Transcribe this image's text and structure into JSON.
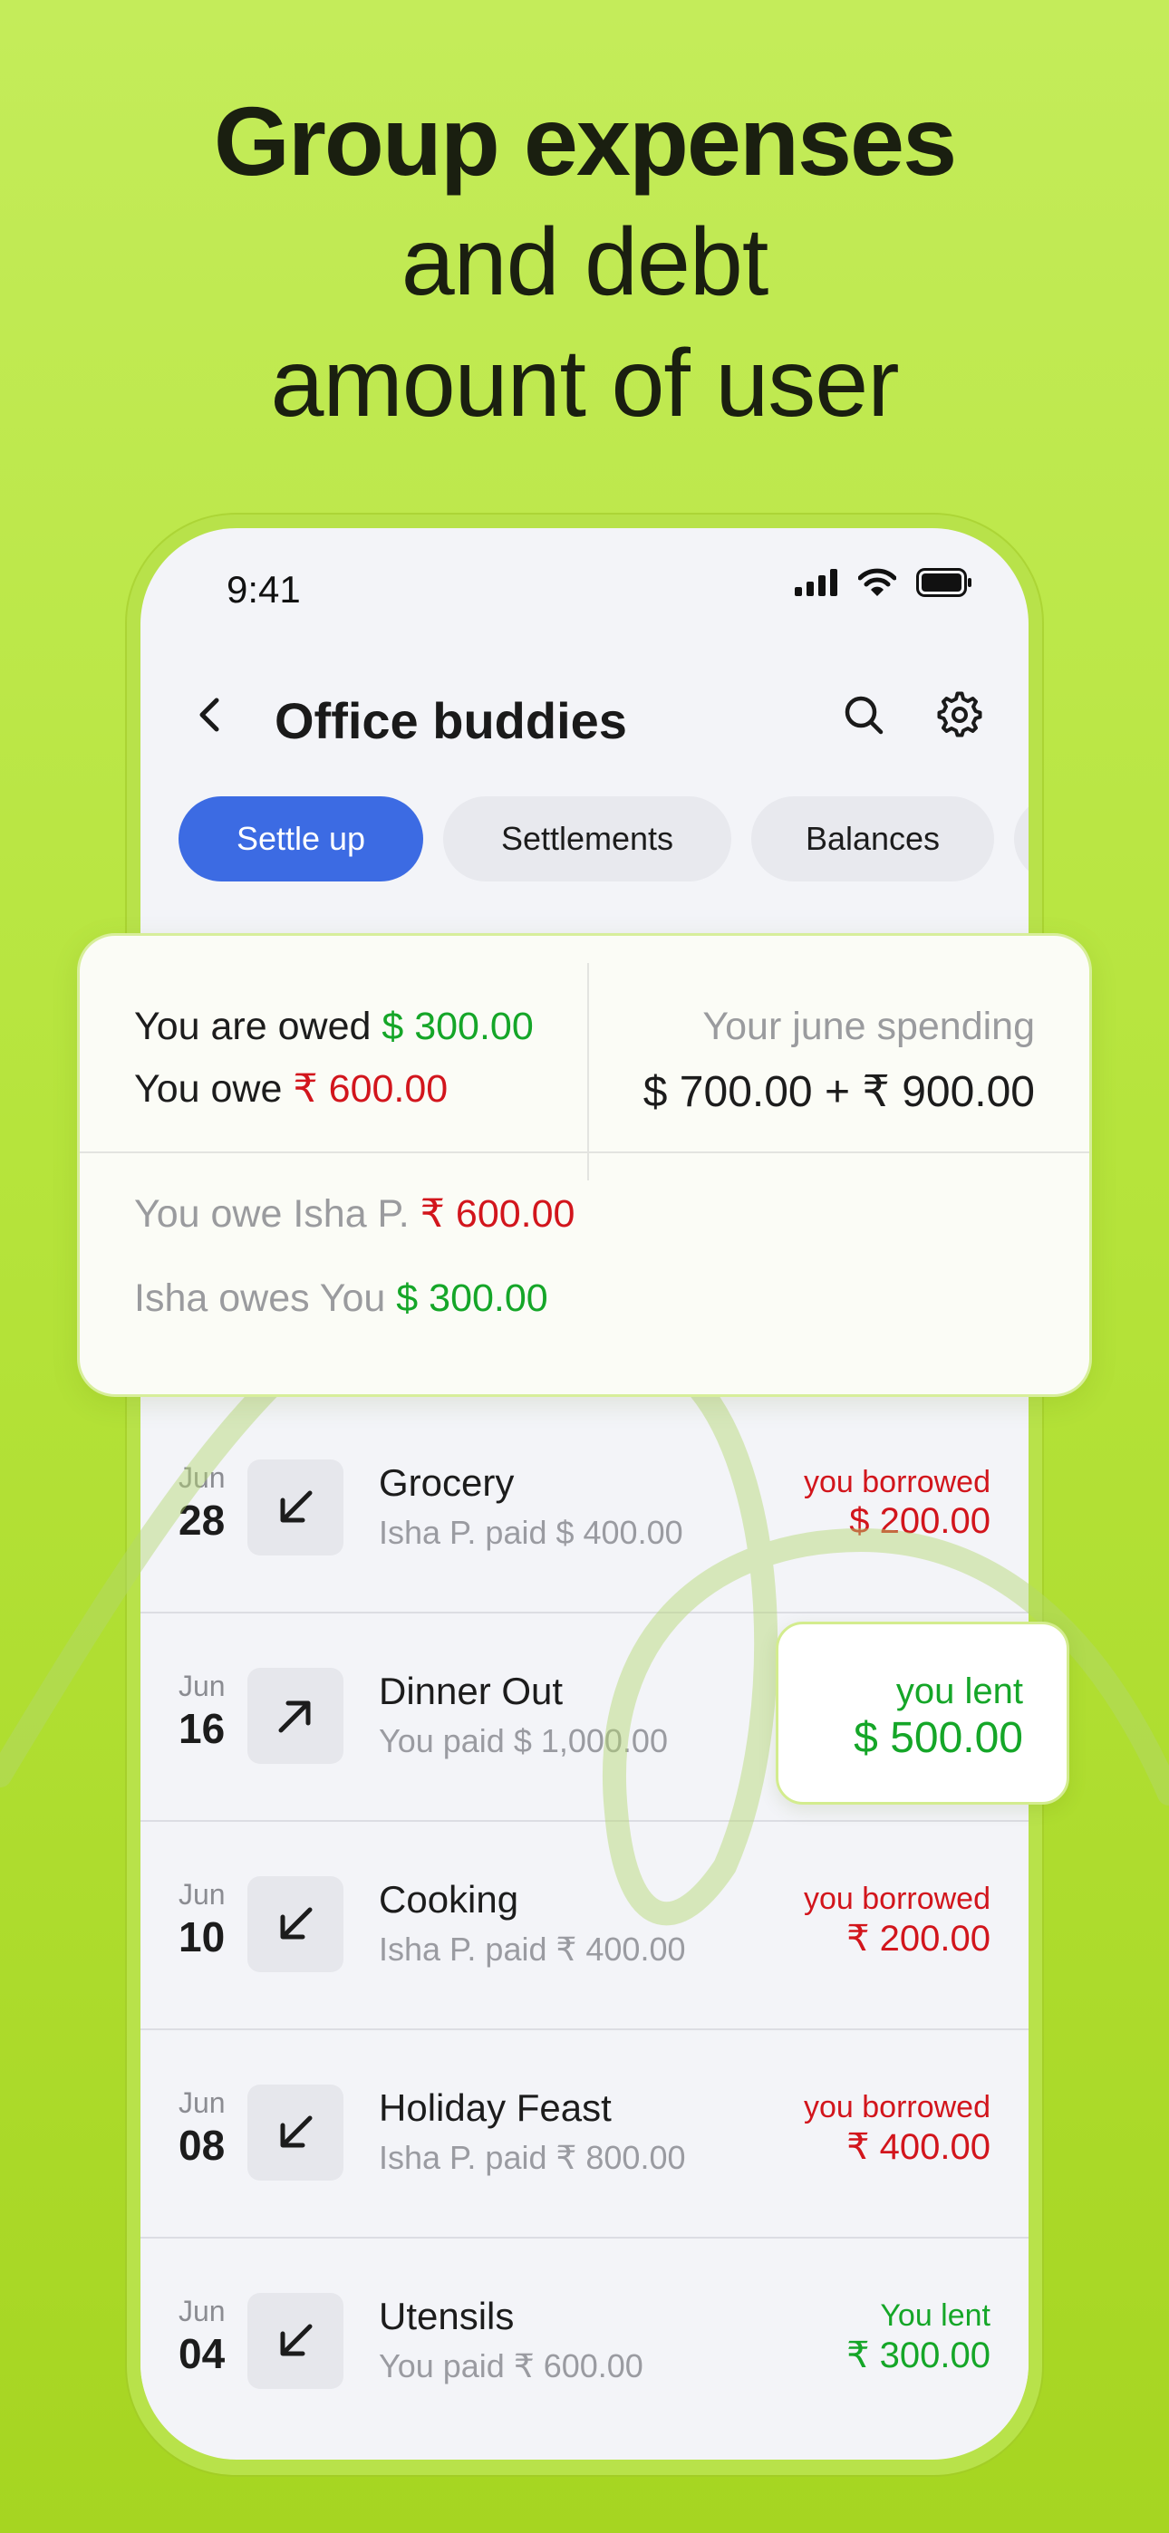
{
  "hero": {
    "line1": "Group expenses",
    "line2": "and debt",
    "line3": "amount of user"
  },
  "status": {
    "time": "9:41"
  },
  "header": {
    "title": "Office buddies"
  },
  "tabs": [
    {
      "label": "Settle up"
    },
    {
      "label": "Settlements"
    },
    {
      "label": "Balances"
    }
  ],
  "summary": {
    "owed_label": "You are owed ",
    "owed_amount": "$ 300.00",
    "owe_label": "You owe ",
    "owe_amount": "₹ 600.00",
    "spending_label": "Your june spending",
    "spending_amount": "$ 700.00 + ₹ 900.00",
    "detail1_label": "You owe Isha P. ",
    "detail1_amount": "₹ 600.00",
    "detail2_label": "Isha owes You ",
    "detail2_amount": "$ 300.00"
  },
  "transactions": [
    {
      "month": "Jun",
      "day": "28",
      "name": "Grocery",
      "sub": "Isha P. paid $ 400.00",
      "status": "you borrowed",
      "amount": "$ 200.00",
      "direction": "in"
    },
    {
      "month": "Jun",
      "day": "16",
      "name": "Dinner Out",
      "sub": "You paid $ 1,000.00",
      "status": "you lent",
      "amount": "$ 500.00",
      "direction": "out"
    },
    {
      "month": "Jun",
      "day": "10",
      "name": "Cooking",
      "sub": "Isha P. paid ₹ 400.00",
      "status": "you borrowed",
      "amount": "₹ 200.00",
      "direction": "in"
    },
    {
      "month": "Jun",
      "day": "08",
      "name": "Holiday Feast",
      "sub": "Isha P. paid ₹ 800.00",
      "status": "you borrowed",
      "amount": "₹ 400.00",
      "direction": "in"
    },
    {
      "month": "Jun",
      "day": "04",
      "name": "Utensils",
      "sub": "You paid ₹ 600.00",
      "status": "You lent",
      "amount": "₹ 300.00",
      "direction": "in"
    }
  ],
  "colors": {
    "accent": "#3c6be3",
    "debt": "#d2151c",
    "credit": "#15a628",
    "background": "#b6e43c"
  },
  "icons": [
    "back-arrow-icon",
    "search-icon",
    "gear-icon",
    "signal-icon",
    "wifi-icon",
    "battery-icon",
    "arrow-down-left-icon",
    "arrow-up-right-icon"
  ]
}
